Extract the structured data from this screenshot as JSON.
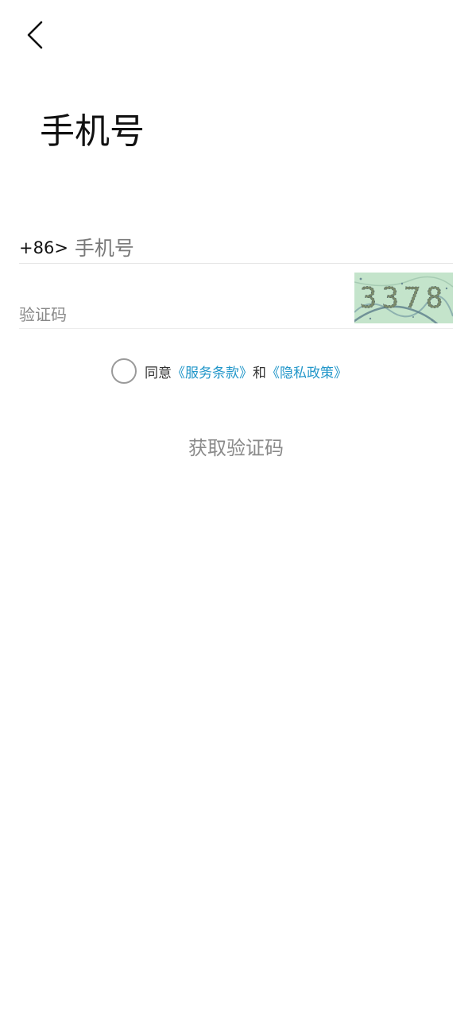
{
  "header": {
    "back_icon": "chevron-left-icon",
    "title": "手机号"
  },
  "form": {
    "country_code": "+86>",
    "phone_placeholder": "手机号",
    "phone_value": "",
    "code_placeholder": "验证码",
    "code_value": "",
    "captcha_text": "3378"
  },
  "agreement": {
    "prefix": "同意",
    "terms_link": "《服务条款》",
    "conjunction": "和",
    "privacy_link": "《隐私政策》",
    "link_color": "#2196c9",
    "checked": false
  },
  "actions": {
    "get_code_label": "获取验证码"
  }
}
